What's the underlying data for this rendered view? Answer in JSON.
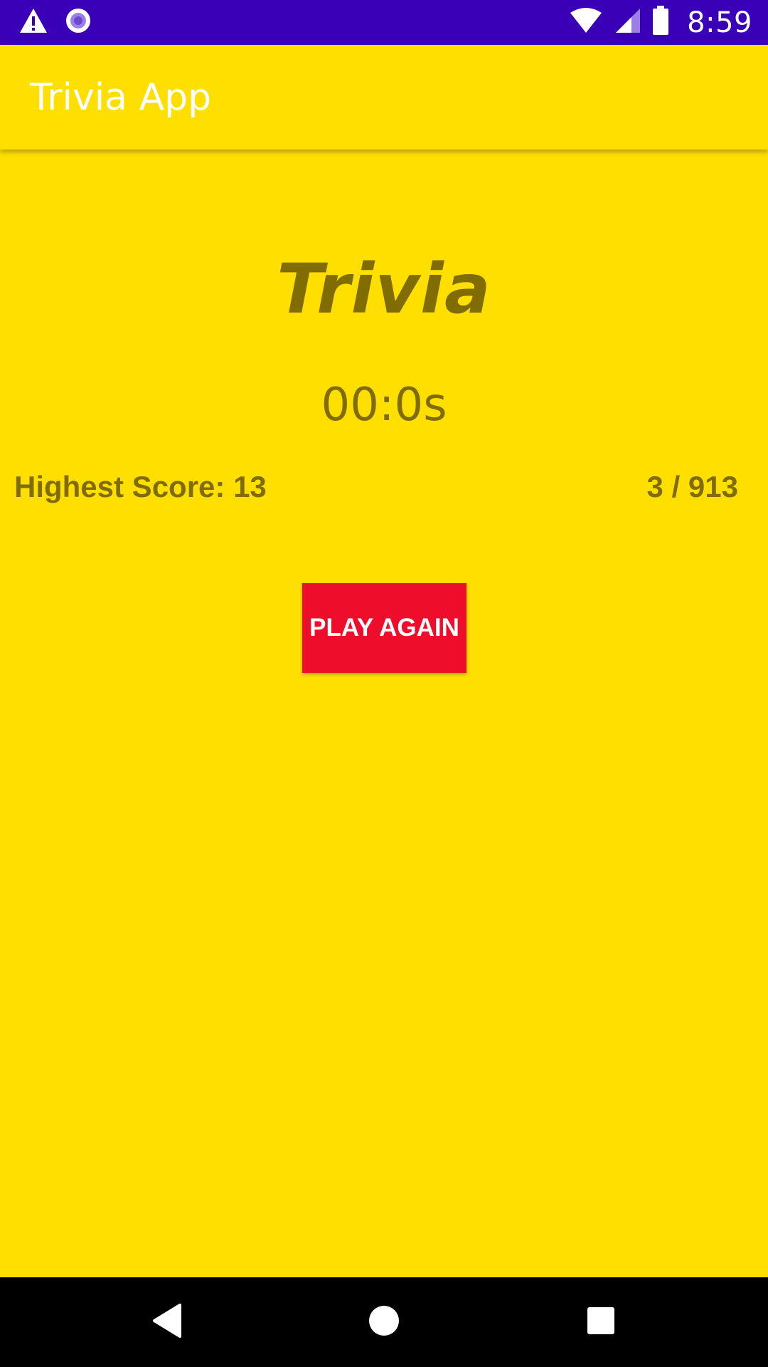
{
  "status_bar": {
    "time": "8:59",
    "left_icons": [
      "warning-icon",
      "radio-icon"
    ],
    "right_icons": [
      "wifi-icon",
      "cell-signal-icon",
      "battery-icon"
    ]
  },
  "app_bar": {
    "title": "Trivia App"
  },
  "game": {
    "title": "Trivia",
    "timer": "00:0s",
    "highest_score": "Highest Score: 13",
    "progress": "3 / 913",
    "play_again_label": "PLAY AGAIN"
  },
  "nav_bar": {
    "buttons": [
      "back-icon",
      "home-icon",
      "recents-icon"
    ]
  },
  "colors": {
    "background": "#FFDF00",
    "status_bar": "#3A00B8",
    "text_dark": "#806C00",
    "button": "#EE0E2B"
  }
}
